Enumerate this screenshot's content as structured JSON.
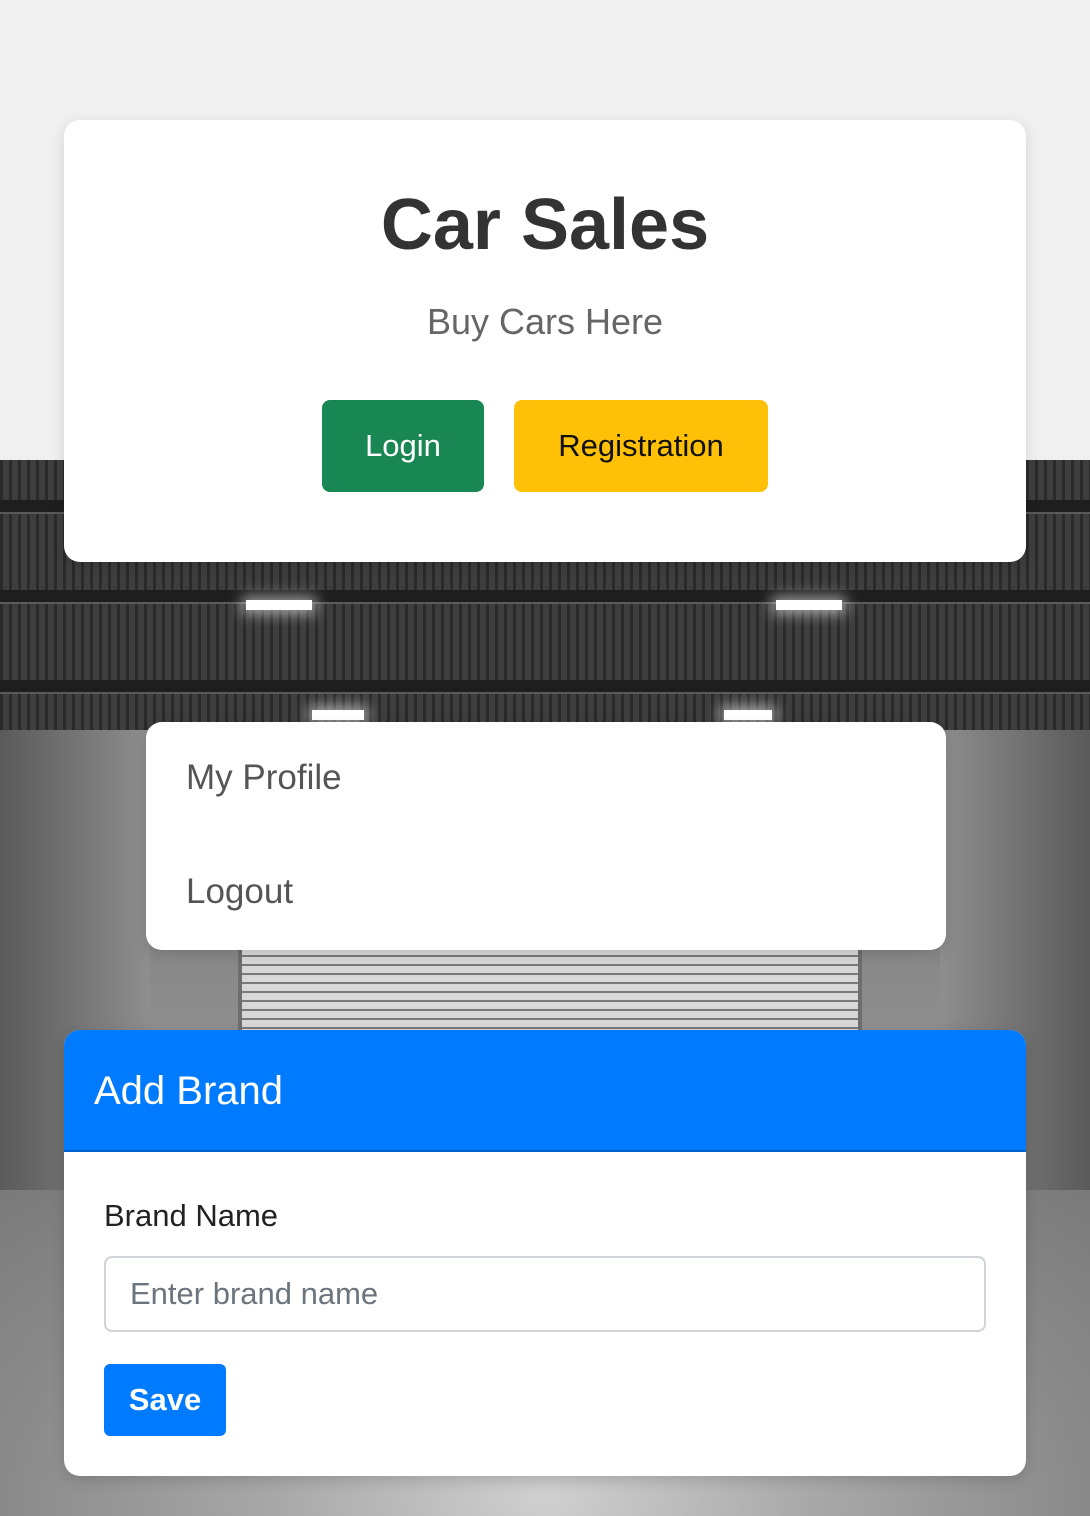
{
  "header": {
    "title": "Car Sales",
    "subtitle": "Buy Cars Here",
    "login_label": "Login",
    "register_label": "Registration"
  },
  "menu": {
    "items": [
      {
        "label": "My Profile"
      },
      {
        "label": "Logout"
      }
    ]
  },
  "brand_form": {
    "title": "Add Brand",
    "field_label": "Brand Name",
    "input_placeholder": "Enter brand name",
    "input_value": "",
    "save_label": "Save"
  },
  "colors": {
    "login_button": "#198754",
    "register_button": "#ffc107",
    "primary": "#007bff",
    "page_background": "#f0f0f0"
  }
}
